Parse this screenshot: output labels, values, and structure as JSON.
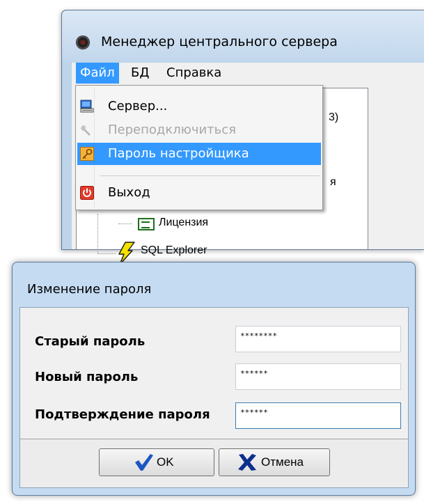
{
  "server_window": {
    "title": "Менеджер центрального сервера",
    "menu": [
      "Файл",
      "БД",
      "Справка"
    ],
    "tree_fragments": {
      "top_right": "3)",
      "mid_right": "я",
      "license": "Лицензия",
      "sql_explorer": "SQL Explorer"
    }
  },
  "file_menu": {
    "items": [
      {
        "label": "Сервер...",
        "icon": "computer-icon",
        "enabled": true
      },
      {
        "label": "Переподключиться",
        "icon": "wrench-icon",
        "enabled": false
      },
      {
        "label": "Пароль настройщика",
        "icon": "key-icon",
        "enabled": true,
        "highlighted": true
      },
      {
        "label": "Выход",
        "icon": "exit-icon",
        "enabled": true
      }
    ]
  },
  "password_dialog": {
    "title": "Изменение пароля",
    "fields": [
      {
        "label": "Старый пароль",
        "value": "********"
      },
      {
        "label": "Новый пароль",
        "value": "******"
      },
      {
        "label": "Подтверждение пароля",
        "value": "******"
      }
    ],
    "ok_label": "OK",
    "cancel_label": "Отмена"
  },
  "colors": {
    "menu_highlight": "#3399ff",
    "ok_check": "#1a57c2",
    "cancel_x": "#0b2f8c",
    "license_icon": "#1d6e1d",
    "sql_bolt": "#f5e200"
  }
}
